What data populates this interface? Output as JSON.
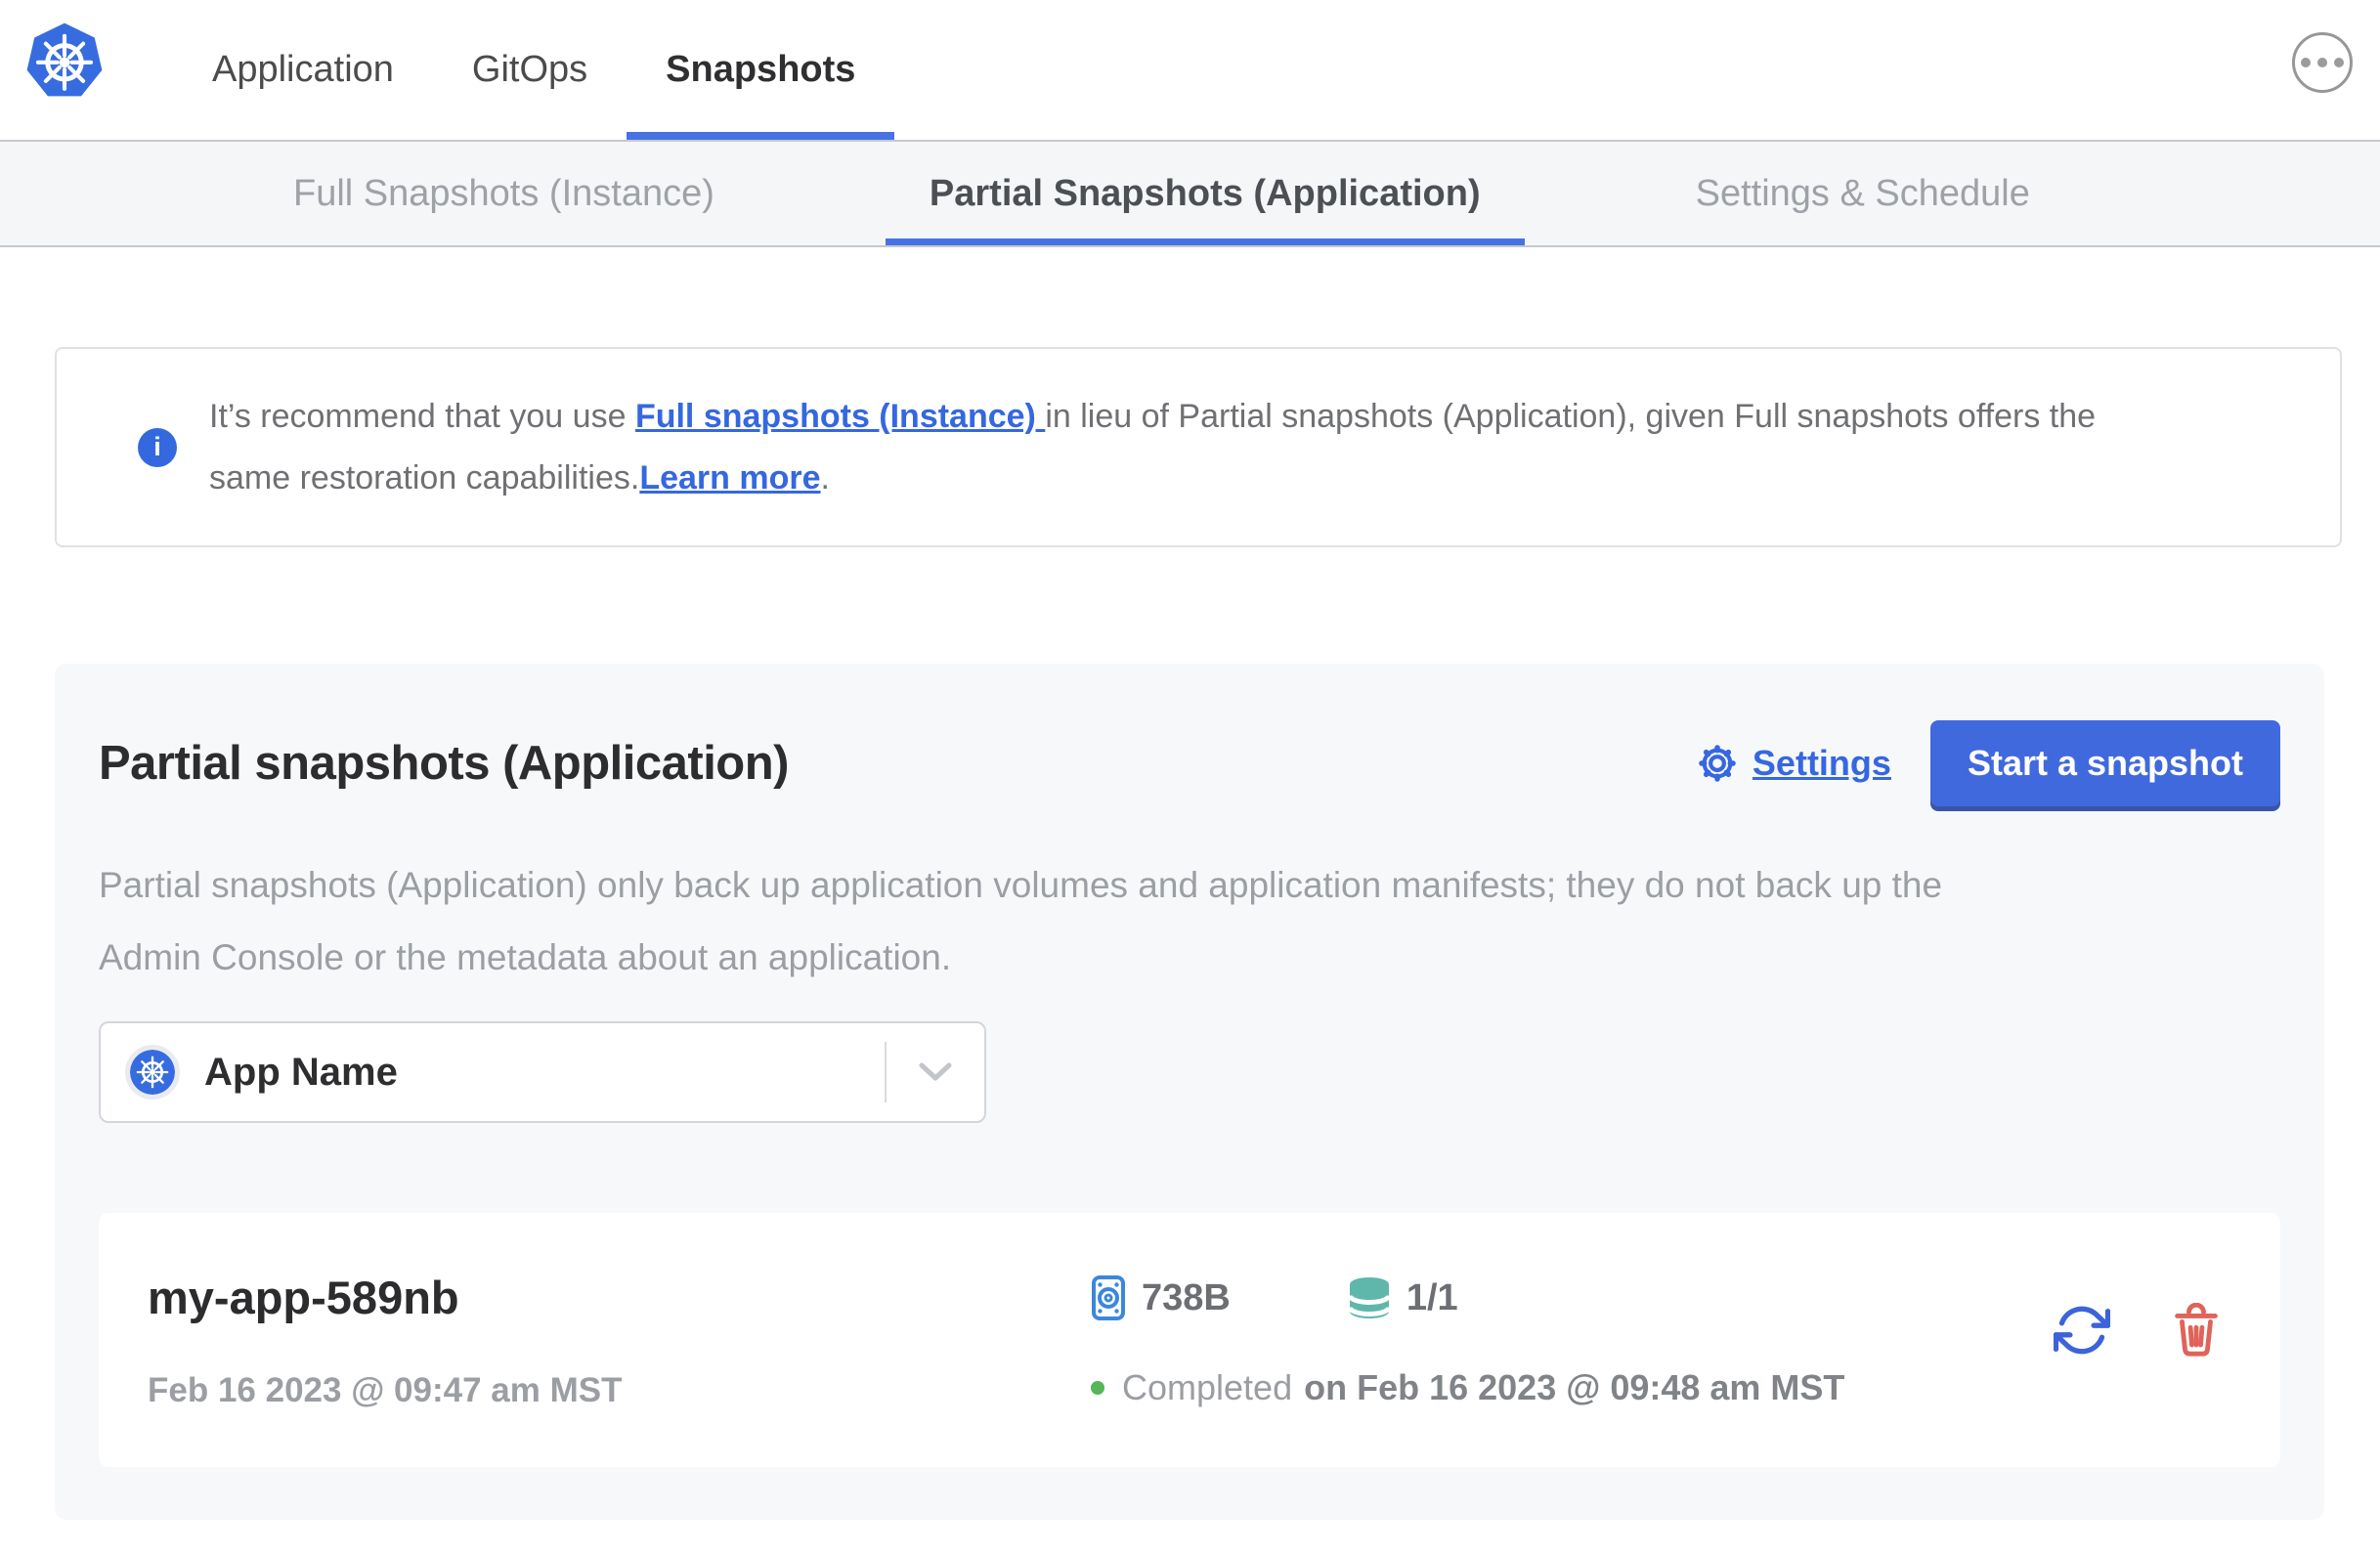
{
  "topnav": {
    "tabs": [
      {
        "label": "Application",
        "active": false
      },
      {
        "label": "GitOps",
        "active": false
      },
      {
        "label": "Snapshots",
        "active": true
      }
    ]
  },
  "subnav": {
    "tabs": [
      {
        "label": "Full Snapshots (Instance)",
        "active": false
      },
      {
        "label": "Partial Snapshots (Application)",
        "active": true
      },
      {
        "label": "Settings & Schedule",
        "active": false
      }
    ]
  },
  "banner": {
    "info_glyph": "i",
    "text_before": "It’s recommend that you use ",
    "link_full_snapshots": "Full snapshots (Instance) ",
    "text_middle": "in lieu of Partial snapshots (Application), given Full snapshots offers the same restoration capabilities.",
    "link_learn_more": "Learn more",
    "text_after": "."
  },
  "panel": {
    "title": "Partial snapshots (Application)",
    "settings_label": "Settings",
    "start_snapshot_label": "Start a snapshot",
    "description": "Partial snapshots (Application) only back up application volumes and application manifests; they do not back up the Admin Console or the metadata about an application.",
    "app_selector_value": "App Name",
    "snapshot": {
      "name": "my-app-589nb",
      "started": "Feb 16 2023 @ 09:47 am MST",
      "size": "738B",
      "volumes": "1/1",
      "status": "Completed",
      "completed_at": "on Feb 16 2023 @ 09:48 am MST"
    }
  },
  "icons": {
    "brand": "kubernetes-logo",
    "menu": "ellipsis-icon",
    "banner": "info-icon",
    "settings": "gear-icon",
    "selector_brand": "kubernetes-icon",
    "selector_caret": "chevron-down-icon",
    "size": "disk-icon",
    "volumes": "database-icon",
    "restore": "restore-icon",
    "delete": "trash-icon"
  },
  "colors": {
    "accent_blue": "#4673e4",
    "link_blue": "#3567e0",
    "button_blue": "#4169de",
    "logo_blue": "#366ce0",
    "disk_blue": "#3b87dd",
    "db_teal": "#5fb7ab",
    "restore_blue": "#3c63da",
    "trash_red": "#e0635a",
    "status_green": "#54b657"
  }
}
